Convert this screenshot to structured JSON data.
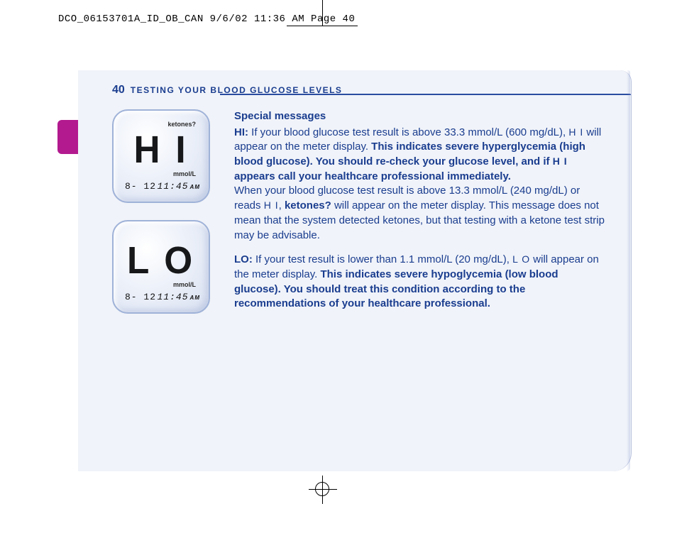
{
  "print_header": "DCO_06153701A_ID_OB_CAN  9/6/02  11:36 AM  Page 40",
  "page": {
    "number": "40",
    "section_title": "TESTING YOUR BLOOD GLUCOSE LEVELS"
  },
  "meters": {
    "hi": {
      "ketones_label": "ketones?",
      "reading": "H I",
      "unit": "mmol/L",
      "date": "8- 12",
      "time": "11:45",
      "ampm": "AM"
    },
    "lo": {
      "reading": "L O",
      "unit": "mmol/L",
      "date": "8- 12",
      "time": "11:45",
      "ampm": "AM"
    }
  },
  "text": {
    "special_heading": "Special messages",
    "hi_label": "HI:",
    "hi_p1a": " If your blood glucose test result is above 33.3 mmol/L (600 mg/dL), ",
    "hi_seg1": "H I",
    "hi_p1b": " will appear on the meter display. ",
    "hi_bold1": "This indicates severe hyperglycemia (high blood glucose). You should re-check your glucose level, and if ",
    "hi_seg2": "H I",
    "hi_bold2": " appears call your healthcare professional immediately.",
    "hi_p2a": "When your blood glucose test result is above 13.3 mmol/L (240 mg/dL) or reads ",
    "hi_seg3": "H I",
    "hi_p2b": ", ",
    "ketones_word": "ketones?",
    "hi_p2c": " will appear on the meter display. This message does not mean that the system detected ketones, but that testing with a ketone test strip may be advisable.",
    "lo_label": "LO:",
    "lo_p1a": " If your test result is lower than 1.1 mmol/L (20 mg/dL), ",
    "lo_seg1": "L O",
    "lo_p1b": " will appear on the meter display. ",
    "lo_bold": "This indicates severe hypoglycemia (low blood glucose). You should treat this condition according to the recommendations of your healthcare professional."
  }
}
